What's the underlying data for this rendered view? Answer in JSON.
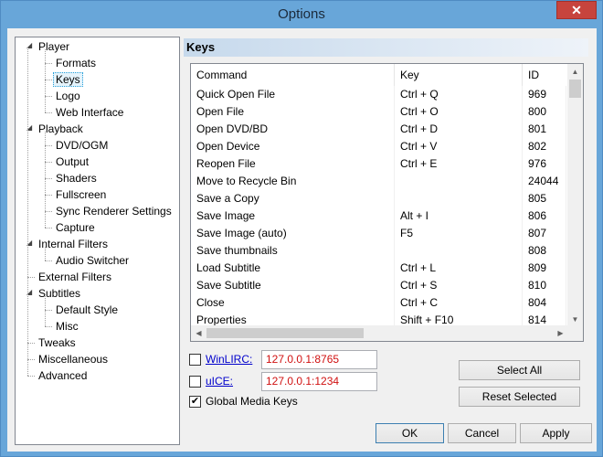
{
  "window": {
    "title": "Options",
    "close_glyph": "✕"
  },
  "tree": {
    "expanded_glyph": "◢",
    "items": [
      {
        "label": "Player",
        "level": 0,
        "expander": true
      },
      {
        "label": "Formats",
        "level": 1
      },
      {
        "label": "Keys",
        "level": 1,
        "selected": true
      },
      {
        "label": "Logo",
        "level": 1
      },
      {
        "label": "Web Interface",
        "level": 1
      },
      {
        "label": "Playback",
        "level": 0,
        "expander": true
      },
      {
        "label": "DVD/OGM",
        "level": 1
      },
      {
        "label": "Output",
        "level": 1
      },
      {
        "label": "Shaders",
        "level": 1
      },
      {
        "label": "Fullscreen",
        "level": 1
      },
      {
        "label": "Sync Renderer Settings",
        "level": 1
      },
      {
        "label": "Capture",
        "level": 1
      },
      {
        "label": "Internal Filters",
        "level": 0,
        "expander": true
      },
      {
        "label": "Audio Switcher",
        "level": 1
      },
      {
        "label": "External Filters",
        "level": 0
      },
      {
        "label": "Subtitles",
        "level": 0,
        "expander": true
      },
      {
        "label": "Default Style",
        "level": 1
      },
      {
        "label": "Misc",
        "level": 1
      },
      {
        "label": "Tweaks",
        "level": 0
      },
      {
        "label": "Miscellaneous",
        "level": 0
      },
      {
        "label": "Advanced",
        "level": 0
      }
    ]
  },
  "panel": {
    "title": "Keys"
  },
  "grid": {
    "columns": [
      "Command",
      "Key",
      "ID"
    ],
    "rows": [
      [
        "Quick Open File",
        "Ctrl + Q",
        "969"
      ],
      [
        "Open File",
        "Ctrl + O",
        "800"
      ],
      [
        "Open DVD/BD",
        "Ctrl + D",
        "801"
      ],
      [
        "Open Device",
        "Ctrl + V",
        "802"
      ],
      [
        "Reopen File",
        "Ctrl + E",
        "976"
      ],
      [
        "Move to Recycle Bin",
        "",
        "24044"
      ],
      [
        "Save a Copy",
        "",
        "805"
      ],
      [
        "Save Image",
        "Alt + I",
        "806"
      ],
      [
        "Save Image (auto)",
        "F5",
        "807"
      ],
      [
        "Save thumbnails",
        "",
        "808"
      ],
      [
        "Load Subtitle",
        "Ctrl + L",
        "809"
      ],
      [
        "Save Subtitle",
        "Ctrl + S",
        "810"
      ],
      [
        "Close",
        "Ctrl + C",
        "804"
      ],
      [
        "Properties",
        "Shift + F10",
        "814"
      ]
    ],
    "scroll_up_glyph": "▲",
    "scroll_down_glyph": "▼",
    "scroll_left_glyph": "◀",
    "scroll_right_glyph": "▶"
  },
  "controls": {
    "winlirc": {
      "label": "WinLIRC:",
      "value": "127.0.0.1:8765",
      "checked": false
    },
    "uice": {
      "label": "uICE:",
      "value": "127.0.0.1:1234",
      "checked": false
    },
    "global_media_keys": {
      "label": "Global Media Keys",
      "checked": true,
      "check_glyph": "✔"
    },
    "select_all": "Select All",
    "reset_selected": "Reset Selected"
  },
  "footer": {
    "ok": "OK",
    "cancel": "Cancel",
    "apply": "Apply"
  },
  "colors": {
    "window_border": "#68a6d9",
    "field_text": "#d01010",
    "link": "#0000cc"
  }
}
